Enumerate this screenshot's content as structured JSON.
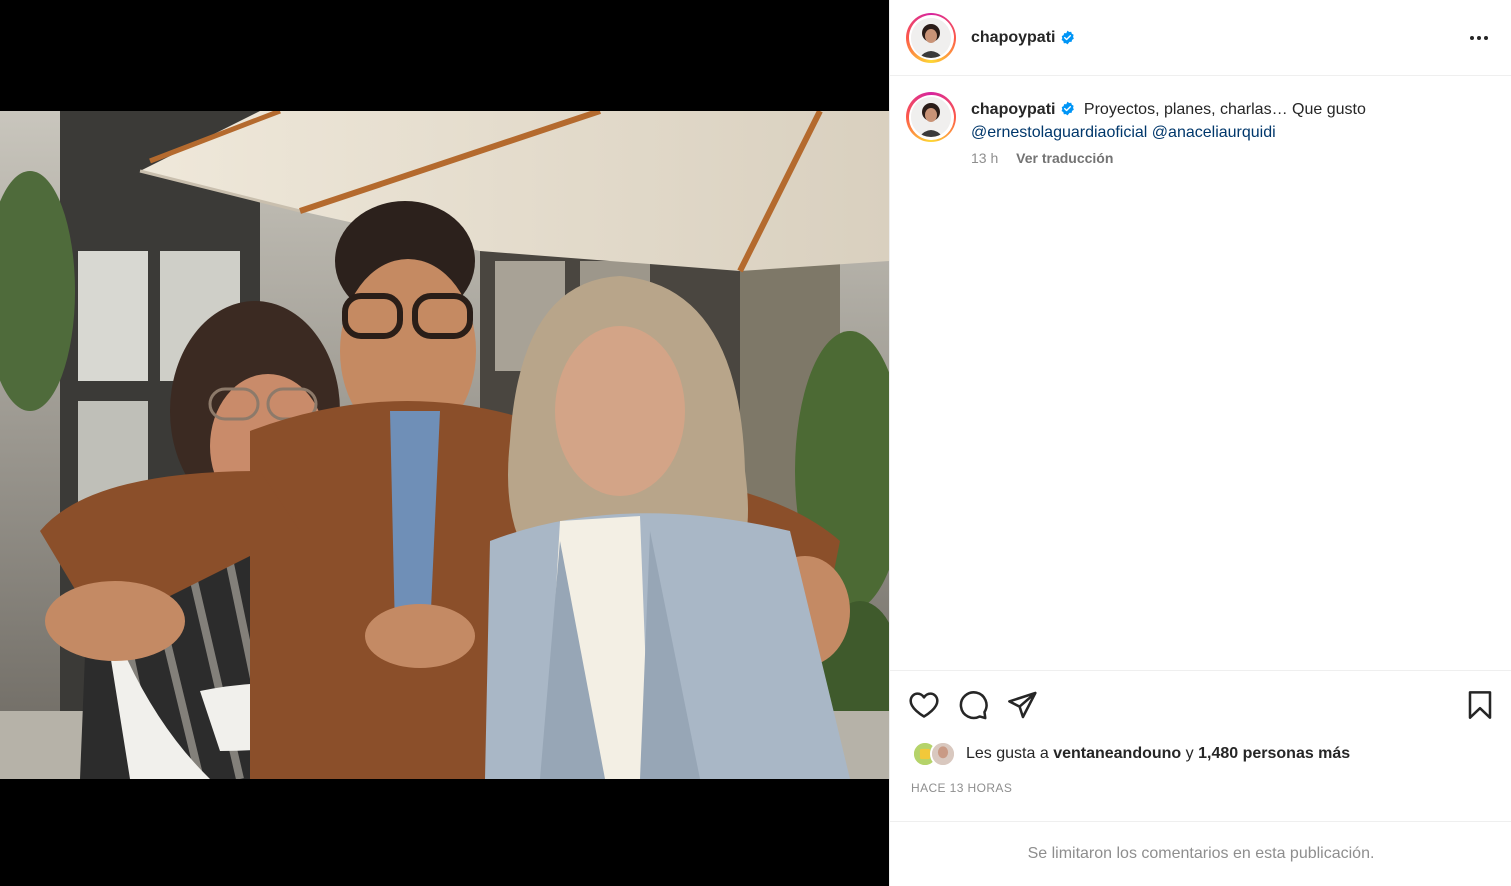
{
  "post": {
    "author": {
      "username": "chapoypati",
      "verified": true
    },
    "caption": {
      "text": "Proyectos, planes, charlas… Que gusto",
      "mentions": [
        "@ernestolaguardiaoficial",
        "@anaceliaurquidi"
      ]
    },
    "time_ago": "13 h",
    "translate_label": "Ver traducción",
    "likes": {
      "prefix": "Les gusta a",
      "first_user": "ventaneandouno",
      "joiner": "y",
      "others": "1,480 personas más"
    },
    "timestamp": "HACE 13 HORAS",
    "comments_disabled_text": "Se limitaron los comentarios en esta publicación."
  },
  "icons": {
    "verified": "verified-badge-icon",
    "more": "more-options-icon",
    "like": "heart-icon",
    "comment": "comment-icon",
    "share": "share-icon",
    "save": "bookmark-icon"
  },
  "colors": {
    "verified": "#0095f6",
    "mention": "#00376b",
    "muted": "#8e8e8e",
    "text": "#262626"
  }
}
